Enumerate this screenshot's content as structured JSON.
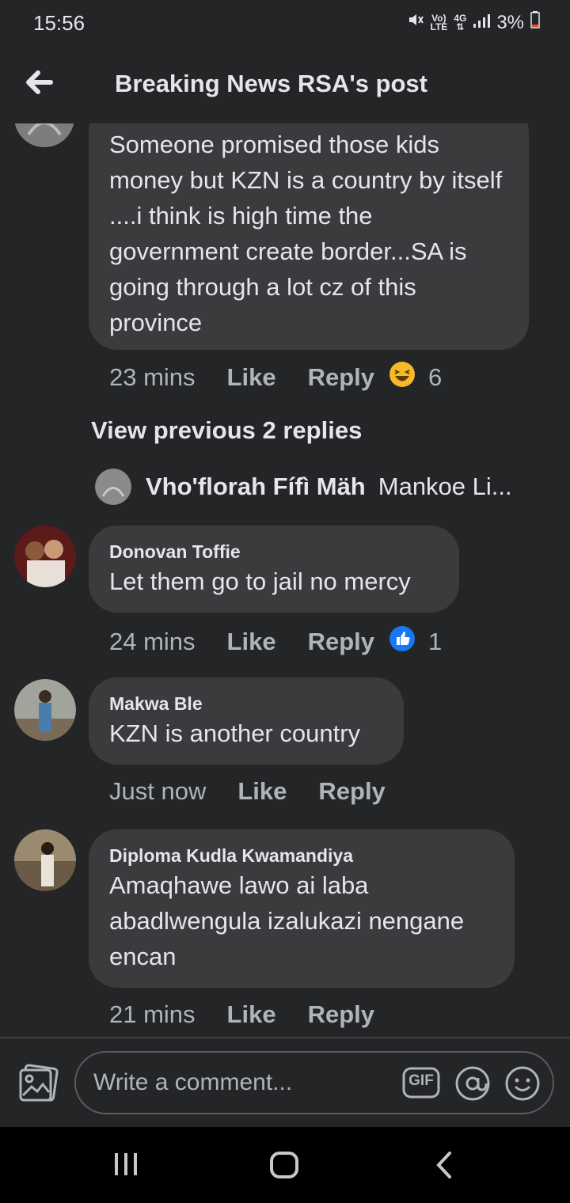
{
  "status_bar": {
    "time": "15:56",
    "network_top": "Vo)",
    "network_bottom": "LTE",
    "signal_label": "4G",
    "battery_percent": "3%"
  },
  "header": {
    "title": "Breaking News RSA's post"
  },
  "comments": [
    {
      "author": "",
      "text": "Someone promised those kids money  but KZN is a country by itself  ....i think is high time the government  create border...SA is going through a lot cz of this province",
      "time": "23 mins",
      "like": "Like",
      "reply": "Reply",
      "reaction": "haha",
      "reaction_count": "6"
    },
    {
      "author": "Donovan Toffie",
      "text": "Let them go to jail no mercy",
      "time": "24 mins",
      "like": "Like",
      "reply": "Reply",
      "reaction": "like",
      "reaction_count": "1"
    },
    {
      "author": "Makwa Ble",
      "text": "KZN is another country",
      "time": "Just now",
      "like": "Like",
      "reply": "Reply"
    },
    {
      "author": "Diploma Kudla Kwamandiya",
      "text": "Amaqhawe lawo ai laba abadlwengula izalukazi nengane encan",
      "time": "21 mins",
      "like": "Like",
      "reply": "Reply"
    }
  ],
  "view_previous": "View previous 2 replies",
  "reply_preview": {
    "author": "Vho'florah Fífì Mäh",
    "text": "Mankoe Li..."
  },
  "composer": {
    "placeholder": "Write a comment...",
    "gif_label": "GIF"
  },
  "colors": {
    "background": "#242526",
    "bubble": "#3a3b3c",
    "text_primary": "#e4e6eb",
    "text_secondary": "#b0b3b8",
    "like_blue": "#1877f2",
    "haha_yellow": "#f7b928"
  }
}
